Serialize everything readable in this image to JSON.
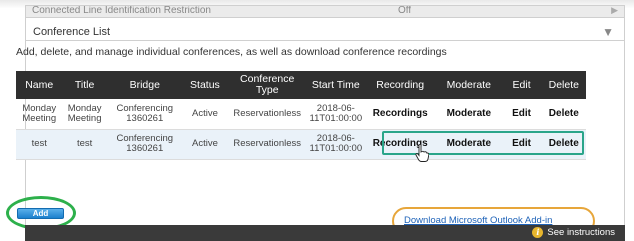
{
  "previous_row": {
    "label": "Connected Line Identification Restriction",
    "value": "Off"
  },
  "section": {
    "title": "Conference List",
    "collapse_icon": "triangle-down-icon"
  },
  "intro_text": "Add, delete, and manage individual conferences, as well as download conference recordings",
  "table": {
    "headers": [
      "Name",
      "Title",
      "Bridge",
      "Status",
      "Conference Type",
      "Start Time",
      "Recording",
      "Moderate",
      "Edit",
      "Delete"
    ],
    "rows": [
      {
        "name": "Monday Meeting",
        "title": "Monday Meeting",
        "bridge": "Conferencing 1360261",
        "status": "Active",
        "type": "Reservationless",
        "start": "2018-06-11T01:00:00",
        "recording": "Recordings",
        "moderate": "Moderate",
        "edit": "Edit",
        "delete": "Delete"
      },
      {
        "name": "test",
        "title": "test",
        "bridge": "Conferencing 1360261",
        "status": "Active",
        "type": "Reservationless",
        "start": "2018-06-11T01:00:00",
        "recording": "Recordings",
        "moderate": "Moderate",
        "edit": "Edit",
        "delete": "Delete"
      }
    ]
  },
  "add_button_label": "Add",
  "outlook_link": "Download Microsoft Outlook Add-in",
  "footer": {
    "help_text": "See instructions",
    "help_icon": "info-icon"
  },
  "colors": {
    "header_bg": "#2f2f2f",
    "highlight_green": "#2db04b",
    "highlight_teal": "#2aa58a",
    "highlight_orange": "#e7a63a",
    "link_blue": "#1d62b8",
    "add_button": "#1b80cd"
  }
}
